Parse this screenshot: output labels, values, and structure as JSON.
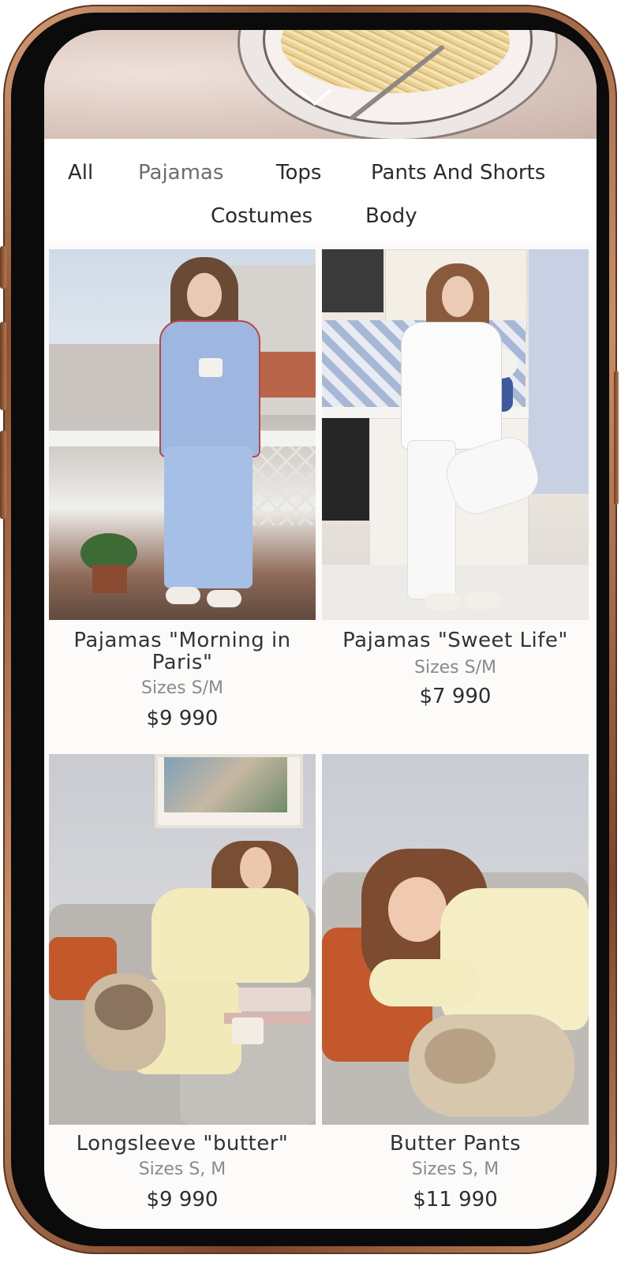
{
  "categories": {
    "all": "All",
    "pajamas": "Pajamas",
    "tops": "Tops",
    "pants_and_shorts": "Pants And Shorts",
    "costumes": "Costumes",
    "body": "Body",
    "active": "Pajamas"
  },
  "products": [
    {
      "name": "Pajamas \"Morning in Paris\"",
      "sizes": "Sizes S/M",
      "price": "$9 990"
    },
    {
      "name": "Pajamas \"Sweet Life\"",
      "sizes": "Sizes S/M",
      "price": "$7 990"
    },
    {
      "name": "Longsleeve \"butter\"",
      "sizes": "Sizes S, M",
      "price": "$9 990"
    },
    {
      "name": "Butter Pants",
      "sizes": "Sizes S, M",
      "price": "$11 990"
    }
  ],
  "colors": {
    "frame": "#b87a52",
    "screen_bg": "#fdfbfa",
    "text_primary": "#2b2b2b",
    "text_secondary": "#8a8a8a"
  }
}
